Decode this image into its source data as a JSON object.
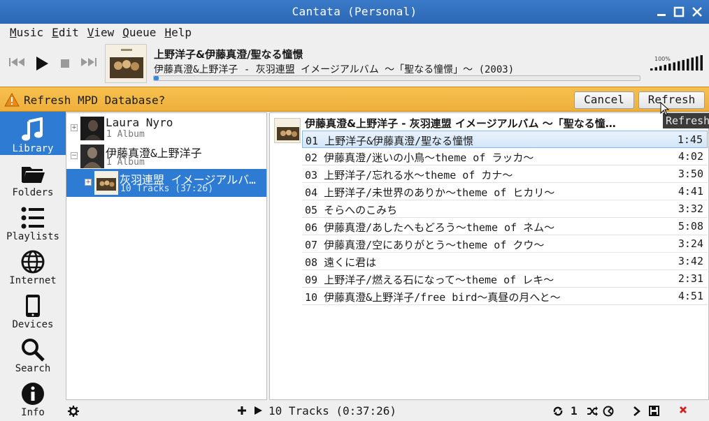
{
  "window": {
    "title": "Cantata (Personal)"
  },
  "menu": [
    {
      "label": "Music",
      "u": "M",
      "rest": "usic"
    },
    {
      "label": "Edit",
      "u": "E",
      "rest": "dit"
    },
    {
      "label": "View",
      "u": "V",
      "rest": "iew"
    },
    {
      "label": "Queue",
      "u": "Q",
      "rest": "ueue"
    },
    {
      "label": "Help",
      "u": "H",
      "rest": "elp"
    }
  ],
  "now_playing": {
    "title": "上野洋子&伊藤真澄/聖なる憧憬",
    "subtitle": "伊藤真澄&上野洋子 - 灰羽連盟 イメージアルバム ～「聖なる憧憬」～ (2003)",
    "progress": 0.01,
    "volume_label": "100%",
    "volume": 1.0
  },
  "refresh_bar": {
    "message": "Refresh MPD Database?",
    "cancel_label": "Cancel",
    "refresh_label": "Refresh",
    "tooltip": "Refresh"
  },
  "sidebar": [
    {
      "label": "Library",
      "icon": "music-note-icon",
      "active": true
    },
    {
      "label": "Folders",
      "icon": "folder-icon",
      "active": false
    },
    {
      "label": "Playlists",
      "icon": "list-icon",
      "active": false
    },
    {
      "label": "Internet",
      "icon": "globe-icon",
      "active": false
    },
    {
      "label": "Devices",
      "icon": "phone-icon",
      "active": false
    },
    {
      "label": "Search",
      "icon": "search-icon",
      "active": false
    },
    {
      "label": "Info",
      "icon": "info-icon",
      "active": false
    }
  ],
  "library": [
    {
      "name": "Laura Nyro",
      "sub": "1 Album",
      "expander": "+"
    },
    {
      "name": "伊藤真澄&上野洋子",
      "sub": "1 Album",
      "expander": "−"
    },
    {
      "name": "灰羽連盟 イメージアルバ…",
      "sub": "10 Tracks (37:26)",
      "expander": "+"
    }
  ],
  "tracks": {
    "album_title": "伊藤真澄&上野洋子 - 灰羽連盟 イメージアルバム ～「聖なる憧…",
    "rows": [
      {
        "text": "01 上野洋子&伊藤真澄/聖なる憧憬",
        "duration": "1:45"
      },
      {
        "text": "02 伊藤真澄/迷いの小鳥～theme of ラッカ～",
        "duration": "4:02"
      },
      {
        "text": "03 上野洋子/忘れる水～theme of カナ～",
        "duration": "3:50"
      },
      {
        "text": "04 上野洋子/未世界のありか～theme of ヒカリ～",
        "duration": "4:41"
      },
      {
        "text": "05 そらへのこみち",
        "duration": "3:32"
      },
      {
        "text": "06 伊藤真澄/あしたへもどろう～theme of ネム～",
        "duration": "5:08"
      },
      {
        "text": "07 伊藤真澄/空にありがとう～theme of クウ～",
        "duration": "3:24"
      },
      {
        "text": "08 遠くに君は",
        "duration": "3:42"
      },
      {
        "text": "09 上野洋子/燃える石になって～theme of レキ～",
        "duration": "2:31"
      },
      {
        "text": "10 伊藤真澄&上野洋子/free bird～真昼の月へと～",
        "duration": "4:51"
      }
    ]
  },
  "status": {
    "count": "10 Tracks (0:37:26)",
    "single_label": "1"
  }
}
